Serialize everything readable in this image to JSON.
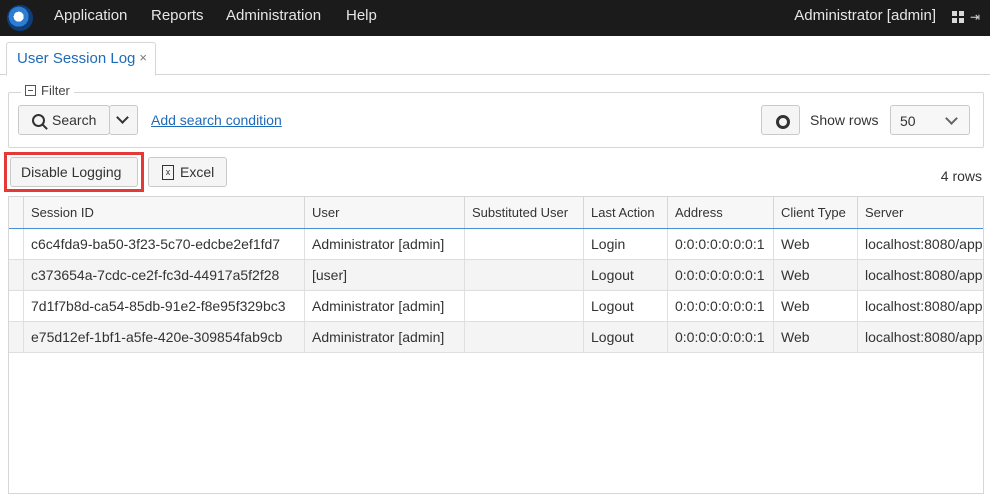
{
  "topbar": {
    "menu": [
      "Application",
      "Reports",
      "Administration",
      "Help"
    ],
    "user": "Administrator [admin]"
  },
  "tab": {
    "label": "User Session Log",
    "close": "×"
  },
  "filter": {
    "legend": "Filter",
    "search_label": "Search",
    "add_condition": "Add search condition",
    "show_rows_label": "Show rows",
    "rows_value": "50"
  },
  "toolbar": {
    "disable_logging": "Disable Logging",
    "excel": "Excel",
    "excel_icon": "x",
    "row_count": "4 rows"
  },
  "table": {
    "columns": [
      "Session ID",
      "User",
      "Substituted User",
      "Last Action",
      "Address",
      "Client Type",
      "Server"
    ],
    "rows": [
      [
        "c6c4fda9-ba50-3f23-5c70-edcbe2ef1fd7",
        "Administrator [admin]",
        "",
        "Login",
        "0:0:0:0:0:0:0:1",
        "Web",
        "localhost:8080/app"
      ],
      [
        "c373654a-7cdc-ce2f-fc3d-44917a5f2f28",
        "[user]",
        "",
        "Logout",
        "0:0:0:0:0:0:0:1",
        "Web",
        "localhost:8080/app"
      ],
      [
        "7d1f7b8d-ca54-85db-91e2-f8e95f329bc3",
        "Administrator [admin]",
        "",
        "Logout",
        "0:0:0:0:0:0:0:1",
        "Web",
        "localhost:8080/app"
      ],
      [
        "e75d12ef-1bf1-a5fe-420e-309854fab9cb",
        "Administrator [admin]",
        "",
        "Logout",
        "0:0:0:0:0:0:0:1",
        "Web",
        "localhost:8080/app"
      ]
    ]
  }
}
